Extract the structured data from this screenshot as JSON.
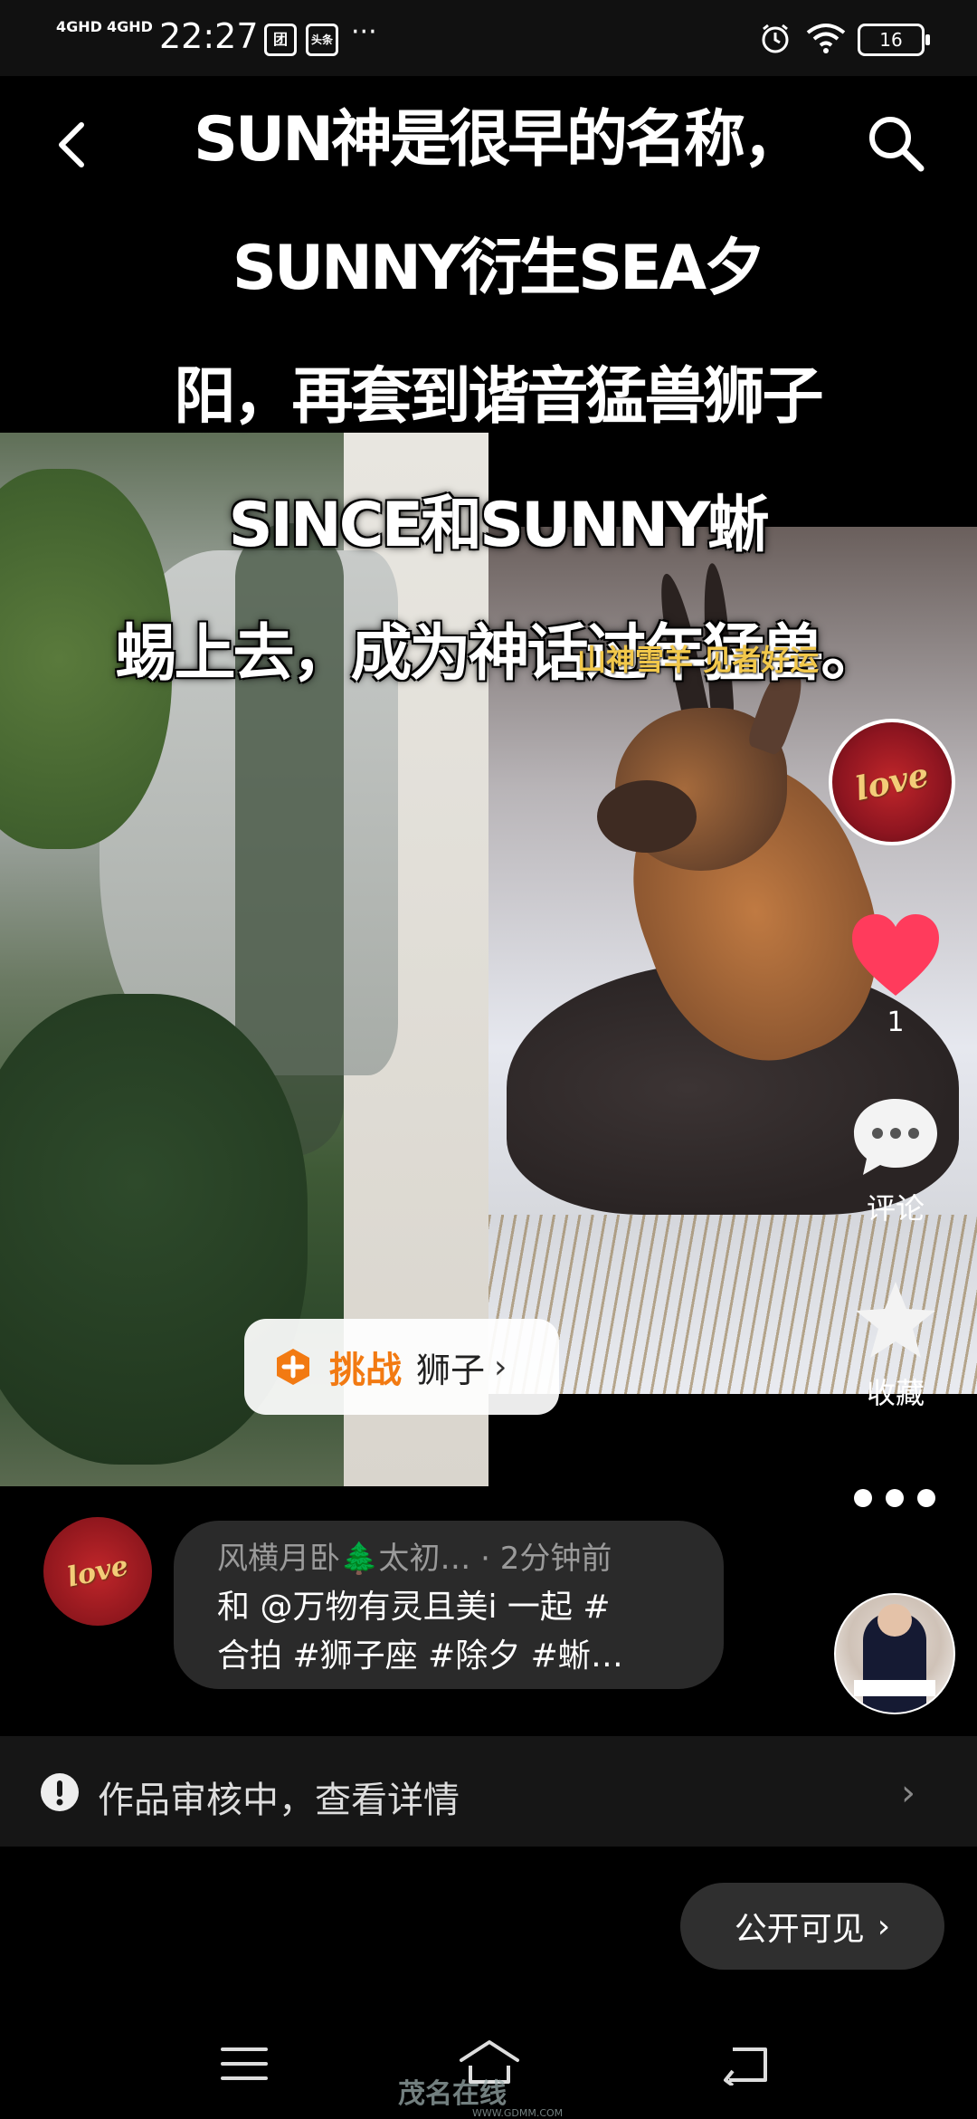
{
  "status_bar": {
    "signal1": "4GHD",
    "signal2": "4GHD",
    "time": "22:27",
    "icon_a": "团",
    "icon_b": "头条",
    "more": "···",
    "battery": "16"
  },
  "video": {
    "caption_lines": [
      "SUN神是很早的名称，SUNNY衍生SEA夕",
      "阳，再套到谐音猛兽狮子SINCE和SUNNY蜥",
      "蜴上去，成为神话过年猛兽。"
    ],
    "overlay_yellow": "山神雪羊 见者好运"
  },
  "side_actions": {
    "creator_avatar_text": "love",
    "likes": "1",
    "comment_label": "评论",
    "favorite_label": "收藏"
  },
  "challenge": {
    "label": "挑战",
    "topic": "狮子",
    "arrow": "›"
  },
  "description": {
    "author_avatar_text": "love",
    "meta": "风横月卧🌲太初…  · 2分钟前",
    "line1": "和 @万物有灵且美i 一起 #",
    "line2": "合拍 #狮子座 #除夕 #蜥…"
  },
  "review": {
    "text": "作品审核中，查看详情",
    "arrow": "›"
  },
  "visibility_button": {
    "label": "公开可见",
    "arrow": "›"
  },
  "watermark": {
    "text": "茂名在线",
    "url": "WWW.GDMM.COM"
  },
  "colors": {
    "accent_orange": "#f27a12",
    "like_red": "#ff3b5c",
    "yellow_text": "#f2c84b"
  },
  "icons": [
    "back-icon",
    "search-icon",
    "heart-icon",
    "comment-icon",
    "star-icon",
    "challenge-icon",
    "alert-icon",
    "menu-icon",
    "home-icon",
    "return-icon"
  ]
}
